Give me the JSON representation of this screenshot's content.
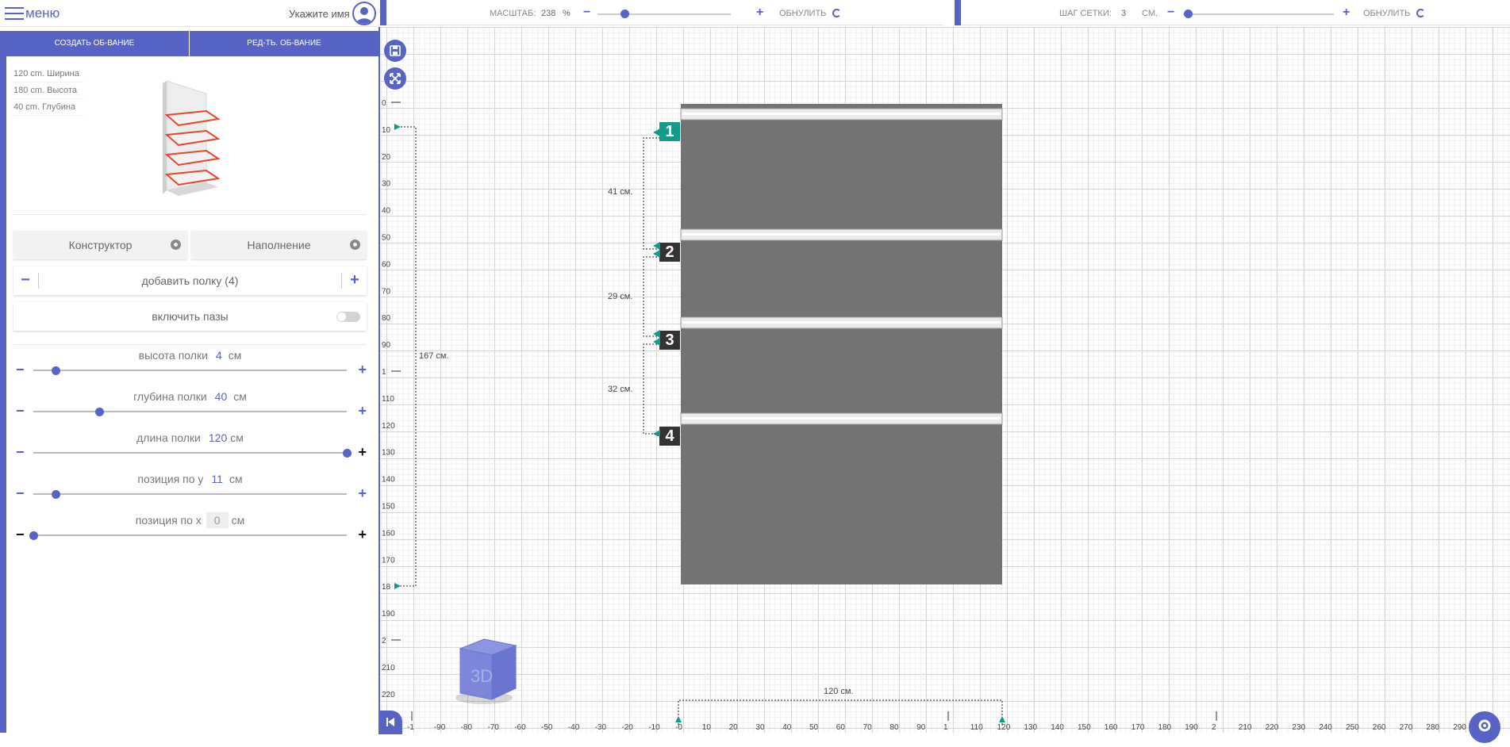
{
  "header": {
    "menu_label": "меню",
    "user_name": "Укажите имя"
  },
  "tabs": [
    {
      "label": "СОЗДАТЬ ОБ-ВАНИЕ"
    },
    {
      "label": "РЕД-ТЬ. ОБ-ВАНИЕ"
    }
  ],
  "dimensions": {
    "width": "120 cm. Ширина",
    "height": "180 cm. Высота",
    "depth": "40 cm. Глубина"
  },
  "buttons": {
    "constructor": "Конструктор",
    "filling": "Наполнение"
  },
  "add_shelf": {
    "label": "добавить полку (4)",
    "minus": "−",
    "plus": "+"
  },
  "grooves": {
    "label": "включить пазы",
    "enabled": false
  },
  "params": [
    {
      "label": "высота полки",
      "value": "4",
      "unit": "см",
      "level": 0.07
    },
    {
      "label": "глубина полки",
      "value": "40",
      "unit": "см",
      "level": 0.21
    },
    {
      "label": "длина полки",
      "value": "120",
      "unit": "см",
      "level": 1.0
    },
    {
      "label": "позиция по y",
      "value": "11",
      "unit": "см",
      "level": 0.07
    },
    {
      "label": "позиция по x",
      "value": "0",
      "unit": "см",
      "level": 0.0
    }
  ],
  "scale_bar": {
    "label": "МАСШТАБ:",
    "value": "238",
    "unit": "%",
    "reset": "ОБНУЛИТЬ",
    "level": 0.2
  },
  "grid_bar": {
    "label": "ШАГ СЕТКИ:",
    "value": "3",
    "unit": "СМ.",
    "reset": "ОБНУЛИТЬ",
    "level": 0.03
  },
  "drawing": {
    "shelf_labels": [
      "1",
      "2",
      "3",
      "4"
    ],
    "gaps": [
      "41 см.",
      "29 см.",
      "32 см."
    ],
    "total_height": "167 см.",
    "total_width": "120 см.",
    "cube_label": "3D",
    "v_ruler": [
      "0",
      "10",
      "20",
      "30",
      "40",
      "50",
      "60",
      "70",
      "80",
      "90",
      "1",
      "110",
      "120",
      "130",
      "140",
      "150",
      "160",
      "170",
      "18",
      "190",
      "2",
      "210",
      "220"
    ],
    "h_ruler": [
      "-1",
      "-90",
      "-80",
      "-70",
      "-60",
      "-50",
      "-40",
      "-30",
      "-20",
      "-10",
      "-0",
      "10",
      "20",
      "30",
      "40",
      "50",
      "60",
      "70",
      "80",
      "90",
      "1",
      "110",
      "120",
      "130",
      "140",
      "150",
      "160",
      "170",
      "180",
      "190",
      "2",
      "210",
      "220",
      "230",
      "240",
      "250",
      "260",
      "270",
      "280",
      "290",
      "3"
    ]
  },
  "colors": {
    "accent": "#5863c6",
    "board": "#737373",
    "teal": "#129b8a",
    "dark": "#333333"
  }
}
